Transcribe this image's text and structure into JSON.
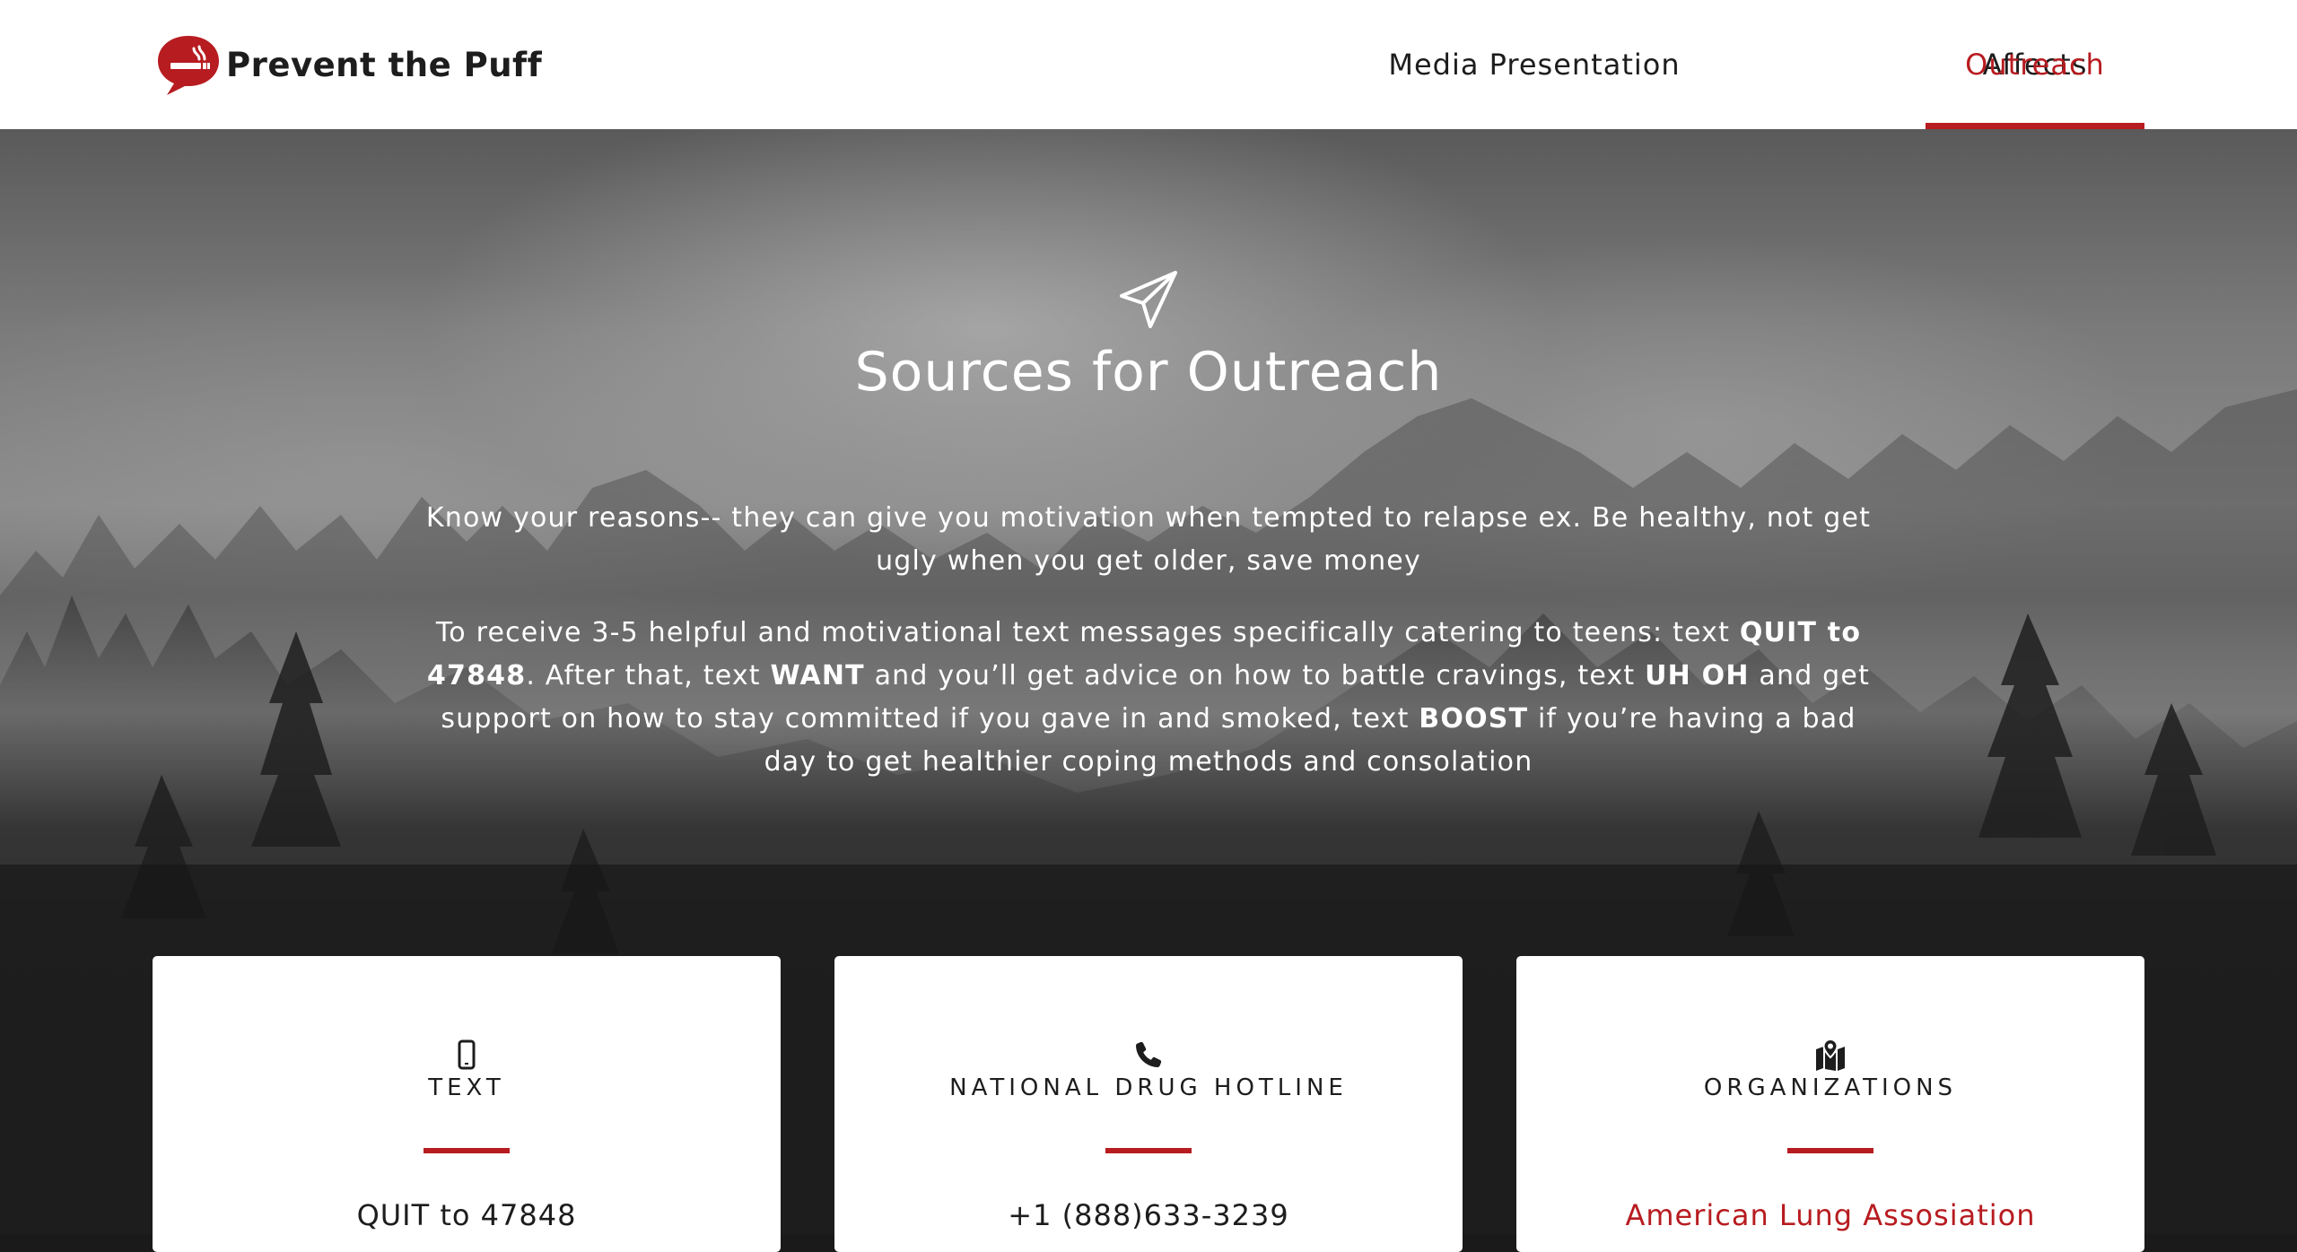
{
  "brand": {
    "name": "Prevent the Puff",
    "logo_icon": "no-smoking-speech-bubble-icon",
    "accent_color": "#b71c20"
  },
  "nav": {
    "items": [
      {
        "label": "Media Presentation",
        "active": false
      },
      {
        "label": "Affects",
        "active": false
      },
      {
        "label": "Outreach",
        "active": true
      }
    ]
  },
  "hero": {
    "icon": "paper-plane-icon",
    "title": "Sources for Outreach",
    "paragraph1": "Know your reasons-- they can give you motivation when tempted to relapse ex. Be healthy, not get ugly when you get older, save money",
    "paragraph2": {
      "t1": "To receive 3-5 helpful and motivational text messages specifically catering to teens: text ",
      "b1": "QUIT to 47848",
      "t2": ". After that, text ",
      "b2": "WANT",
      "t3": " and you’ll get advice on how to battle cravings, text ",
      "b3": "UH OH",
      "t4": " and get support on how to stay committed if you gave in and smoked, text ",
      "b4": "BOOST",
      "t5": " if you’re having a bad day to get healthier coping methods and consolation"
    }
  },
  "cards": [
    {
      "icon": "mobile-phone-icon",
      "title": "Text",
      "body": "QUIT to 47848"
    },
    {
      "icon": "phone-icon",
      "title": "National Drug Hotline",
      "body": "+1 (888)633-3239"
    },
    {
      "icon": "map-marker-icon",
      "title": "Organizations",
      "body": "American Lung Assosiation"
    }
  ]
}
